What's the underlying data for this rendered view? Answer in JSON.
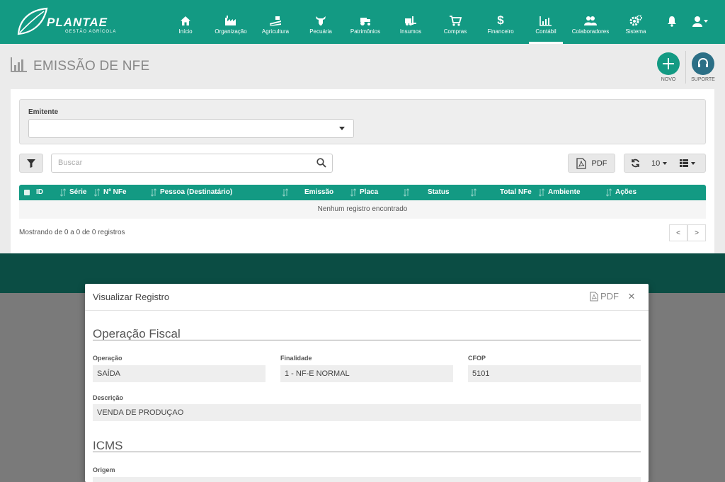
{
  "brand": {
    "name": "PLANTAE",
    "tagline": "GESTÃO AGRÍCOLA"
  },
  "nav": {
    "items": [
      {
        "label": "Início",
        "icon": "home-icon"
      },
      {
        "label": "Organização",
        "icon": "factory-icon"
      },
      {
        "label": "Agricultura",
        "icon": "tractor-field-icon"
      },
      {
        "label": "Pecuária",
        "icon": "cow-icon"
      },
      {
        "label": "Patrimônios",
        "icon": "tractor-icon"
      },
      {
        "label": "Insumos",
        "icon": "forklift-icon"
      },
      {
        "label": "Compras",
        "icon": "cart-icon"
      },
      {
        "label": "Financeiro",
        "icon": "dollar-icon"
      },
      {
        "label": "Contábil",
        "icon": "chart-icon"
      },
      {
        "label": "Colaboradores",
        "icon": "users-icon"
      },
      {
        "label": "Sistema",
        "icon": "gears-icon"
      }
    ],
    "active": "Contábil"
  },
  "page": {
    "title": "EMISSÃO DE NFE"
  },
  "actions": {
    "novo": "NOVO",
    "suporte": "SUPORTE"
  },
  "filter": {
    "emitente_label": "Emitente",
    "emitente_value": ""
  },
  "toolbar": {
    "search_placeholder": "Buscar",
    "pdf": "PDF",
    "page_size": "10"
  },
  "table": {
    "columns": [
      "ID",
      "Série",
      "Nº NFe",
      "Pessoa (Destinatário)",
      "Emissão",
      "Placa",
      "Status",
      "Total NFe",
      "Ambiente",
      "Ações"
    ],
    "empty": "Nenhum registro encontrado"
  },
  "pagination": {
    "info": "Mostrando de 0 a 0 de 0 registros",
    "prev": "<",
    "next": ">"
  },
  "modal": {
    "title": "Visualizar Registro",
    "pdf": "PDF",
    "close": "×",
    "sections": {
      "fiscal": {
        "title": "Operação Fiscal",
        "operacao_label": "Operação",
        "operacao_value": "SAÍDA",
        "finalidade_label": "Finalidade",
        "finalidade_value": "1 - NF-E NORMAL",
        "cfop_label": "CFOP",
        "cfop_value": "5101",
        "descricao_label": "Descrição",
        "descricao_value": "VENDA DE PRODUÇAO"
      },
      "icms": {
        "title": "ICMS",
        "origem_label": "Origem"
      }
    }
  },
  "colors": {
    "primary": "#139a83",
    "overlay": "#0b4d44"
  }
}
